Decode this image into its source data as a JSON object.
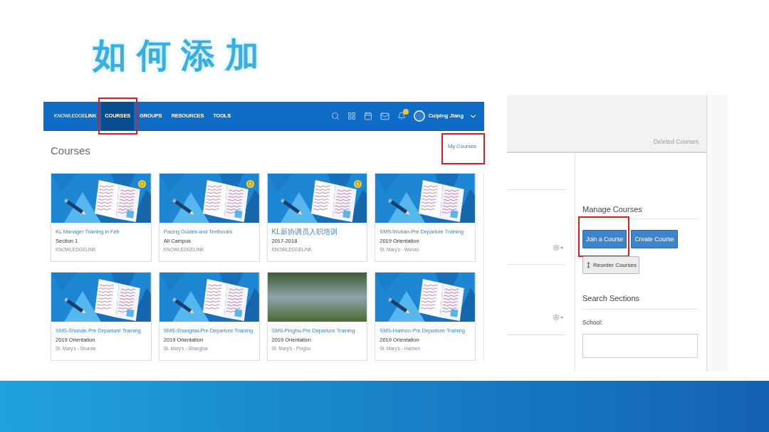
{
  "slide_title": "如何添加",
  "lms_page": {
    "navbar": {
      "logo": "KNOWLEDGE**LINK**",
      "items": [
        {
          "label": "COURSES",
          "selected": true,
          "highlighted": true
        },
        {
          "label": "GROUPS",
          "selected": false,
          "highlighted": false
        },
        {
          "label": "RESOURCES",
          "selected": false,
          "highlighted": false
        },
        {
          "label": "TOOLS",
          "selected": false,
          "highlighted": false
        }
      ],
      "user_name": "Cuiping Jiang"
    },
    "heading": "Courses",
    "my_courses_link": {
      "label": "My Courses",
      "highlighted": true
    },
    "cards": [
      {
        "title": "KL Manager Training in Feb",
        "subtitle": "Section 1",
        "organization": "KNOWLEDGELINK",
        "kind": "illustration",
        "badge": true
      },
      {
        "title": "Pacing Guides and Textbooks",
        "subtitle": "All Campus",
        "organization": "KNOWLEDGELINK",
        "kind": "illustration",
        "badge": true
      },
      {
        "title": "KL新协调员入职培训",
        "subtitle": "2017-2018",
        "organization": "KNOWLEDGELINK",
        "kind": "illustration",
        "badge": true
      },
      {
        "title": "SMS-Wuhan-Pre Departure Training",
        "subtitle": "2019 Orientation",
        "organization": "St. Mary's - Wuhan",
        "kind": "illustration",
        "badge": false
      },
      {
        "title": "SMS-Shunde-Pre Departure Training",
        "subtitle": "2019 Orientation",
        "organization": "St. Mary's - Shunde",
        "kind": "illustration",
        "badge": false
      },
      {
        "title": "SMS-Shanghai-Pre Departure Training",
        "subtitle": "2019 Orientation",
        "organization": "St. Mary's - Shanghai",
        "kind": "illustration",
        "badge": false
      },
      {
        "title": "SMS-Pinghu-Pre Departure Training",
        "subtitle": "2019 Orientation",
        "organization": "St. Mary's - Pinghu",
        "kind": "photo",
        "badge": false
      },
      {
        "title": "SMS-Haimen-Pre Departure Training",
        "subtitle": "2019 Orientation",
        "organization": "St. Mary's - Haimen",
        "kind": "illustration",
        "badge": false
      }
    ]
  },
  "course_settings": {
    "deleted_courses_link": "Deleted Courses",
    "manage_courses": {
      "heading": "Manage Courses",
      "buttons": [
        {
          "label": "Join a Course",
          "kind": "primary",
          "highlighted": true
        },
        {
          "label": "Create Course",
          "kind": "primary",
          "highlighted": false
        },
        {
          "label": "Reorder Courses",
          "kind": "reorder",
          "highlighted": false
        }
      ]
    },
    "search_sections": {
      "heading": "Search Sections",
      "school_label": "School:"
    }
  }
}
